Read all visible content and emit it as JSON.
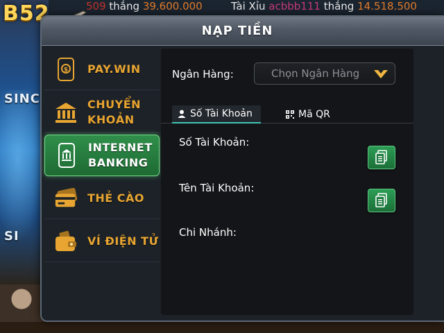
{
  "ticker": {
    "left_num": "509",
    "left_word": "thắng",
    "left_amount": "39.600.000",
    "game": "Tài Xỉu",
    "user": "acbbb111",
    "right_word": "thắng",
    "right_amount": "14.518.500"
  },
  "background": {
    "logo_text": "B52",
    "promo_top": "SINC",
    "promo_bottom": "SI"
  },
  "modal": {
    "title": "NẠP TIỀN"
  },
  "sidebar": {
    "items": [
      {
        "label": "PAY.WIN",
        "icon": "paywin-phone-icon",
        "active": false
      },
      {
        "label": "CHUYỂN\nKHOẢN",
        "icon": "bank-icon",
        "active": false
      },
      {
        "label": "INTERNET\nBANKING",
        "icon": "mobile-banking-icon",
        "active": true
      },
      {
        "label": "THẺ CÀO",
        "icon": "card-icon",
        "active": false
      },
      {
        "label": "VÍ ĐIỆN TỬ",
        "icon": "wallet-icon",
        "active": false
      }
    ]
  },
  "bank": {
    "label": "Ngân Hàng:",
    "select_placeholder": "Chọn Ngân Hàng"
  },
  "tabs": [
    {
      "label": "Số Tài Khoản",
      "icon": "user-icon",
      "active": true
    },
    {
      "label": "Mã QR",
      "icon": "qr-icon",
      "active": false
    }
  ],
  "fields": {
    "account_number_label": "Số Tài Khoản:",
    "account_name_label": "Tên Tài Khoản:",
    "branch_label": "Chi Nhánh:"
  },
  "colors": {
    "accent_gold": "#e8a531",
    "active_green": "#2f8f4a",
    "tab_underline": "#3ec6b6"
  }
}
